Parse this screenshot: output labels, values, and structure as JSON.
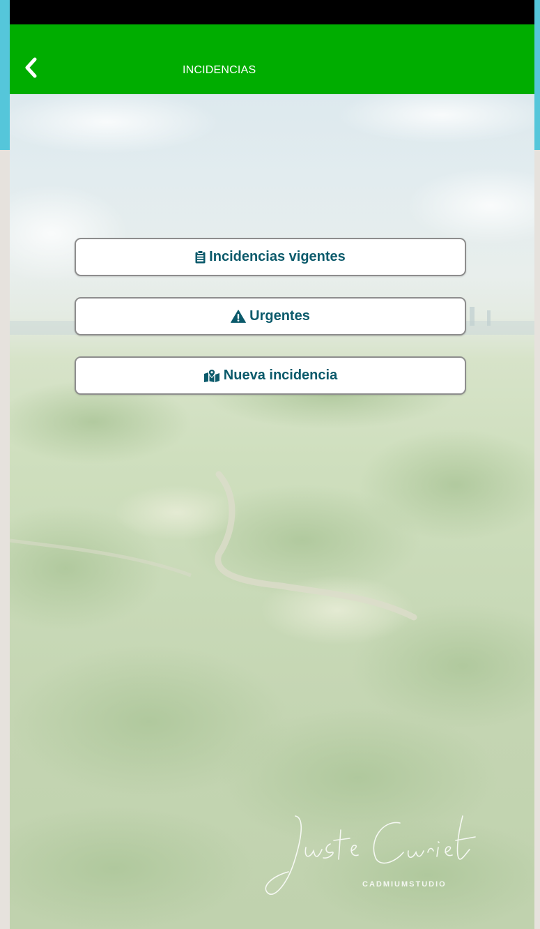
{
  "app": {
    "title": "INCIDENCIAS"
  },
  "colors": {
    "appbar": "#00ad00",
    "button_text": "#0b5a6b",
    "button_border": "#8d8d8d",
    "outer_frame": "#55c6da"
  },
  "menu": {
    "items": [
      {
        "label": "Incidencias vigentes",
        "icon": "clipboard-list-icon"
      },
      {
        "label": "Urgentes",
        "icon": "warning-triangle-icon"
      },
      {
        "label": "Nueva incidencia",
        "icon": "map-marker-icon"
      }
    ]
  },
  "background": {
    "watermark_signature": "Juste Curiel",
    "watermark_studio": "CADMIUMSTUDIO"
  }
}
